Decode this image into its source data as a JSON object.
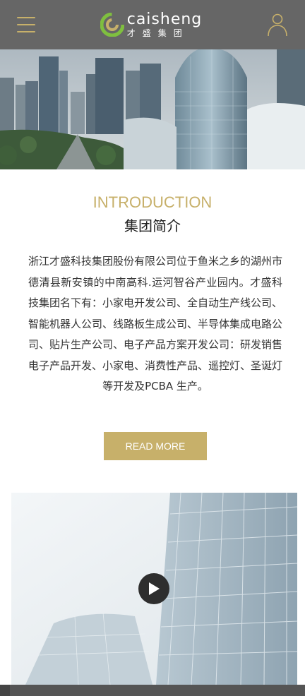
{
  "header": {
    "logo_en": "caisheng",
    "logo_cn": "才盛集团",
    "menu_icon": "hamburger-menu-icon",
    "user_icon": "user-icon"
  },
  "intro": {
    "title": "INTRODUCTION",
    "subtitle": "集团简介",
    "body": "浙江才盛科技集团股份有限公司位于鱼米之乡的湖州市德清县新安镇的中南高科.运河智谷产业园内。才盛科技集团名下有：小家电开发公司、全自动生产线公司、智能机器人公司、线路板生成公司、半导体集成电路公司、贴片生产公司、电子产品方案开发公司：研发销售电子产品开发、小家电、消费性产品、遥控灯、圣诞灯等开发及PCBA 生产。",
    "read_more": "READ MORE"
  },
  "colors": {
    "accent": "#c7b06a",
    "header_bg": "#666666",
    "text": "#333333"
  },
  "video": {
    "play_icon": "play-icon"
  }
}
